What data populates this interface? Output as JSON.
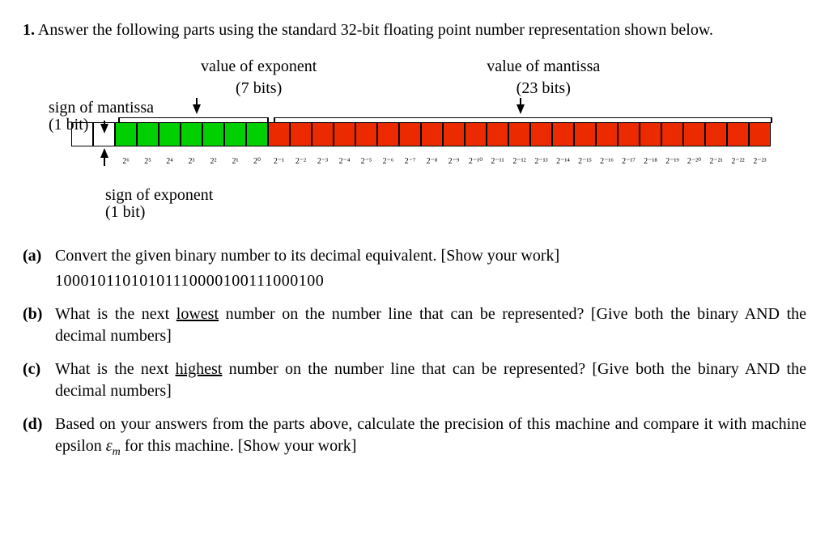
{
  "question": {
    "number": "1.",
    "prompt": "Answer the following parts using the standard 32-bit floating point number representation shown below."
  },
  "diagram": {
    "exponent_label": "value of exponent",
    "exponent_bits": "(7 bits)",
    "mantissa_label": "value of mantissa",
    "mantissa_bits": "(23 bits)",
    "sign_mantissa_label": "sign of mantissa",
    "sign_mantissa_bits": "(1 bit)",
    "sign_exponent_label": "sign of exponent",
    "sign_exponent_bits": "(1 bit)",
    "powers": [
      "2⁶",
      "2⁵",
      "2⁴",
      "2³",
      "2²",
      "2¹",
      "2⁰",
      "2⁻¹",
      "2⁻²",
      "2⁻³",
      "2⁻⁴",
      "2⁻⁵",
      "2⁻⁶",
      "2⁻⁷",
      "2⁻⁸",
      "2⁻⁹",
      "2⁻¹⁰",
      "2⁻¹¹",
      "2⁻¹²",
      "2⁻¹³",
      "2⁻¹⁴",
      "2⁻¹⁵",
      "2⁻¹⁶",
      "2⁻¹⁷",
      "2⁻¹⁸",
      "2⁻¹⁹",
      "2⁻²⁰",
      "2⁻²¹",
      "2⁻²²",
      "2⁻²³"
    ]
  },
  "parts": {
    "a": {
      "label": "(a)",
      "text": "Convert the given binary number to its decimal equivalent. [Show your work]",
      "binary": "10001011010101110000100111000100"
    },
    "b": {
      "label": "(b)",
      "text_before": "What is the next ",
      "underlined": "lowest",
      "text_after": " number on the number line that can be represented? [Give both the binary AND the decimal numbers]"
    },
    "c": {
      "label": "(c)",
      "text_before": "What is the next ",
      "underlined": "highest",
      "text_after": " number on the number line that can be represented? [Give both the binary AND the decimal numbers]"
    },
    "d": {
      "label": "(d)",
      "text_before": "Based on your answers from the parts above, calculate the precision of this machine and compare it with machine epsilon ",
      "epsilon": "ε",
      "epsilon_sub": "m",
      "text_after": " for this machine. [Show your work]"
    }
  }
}
